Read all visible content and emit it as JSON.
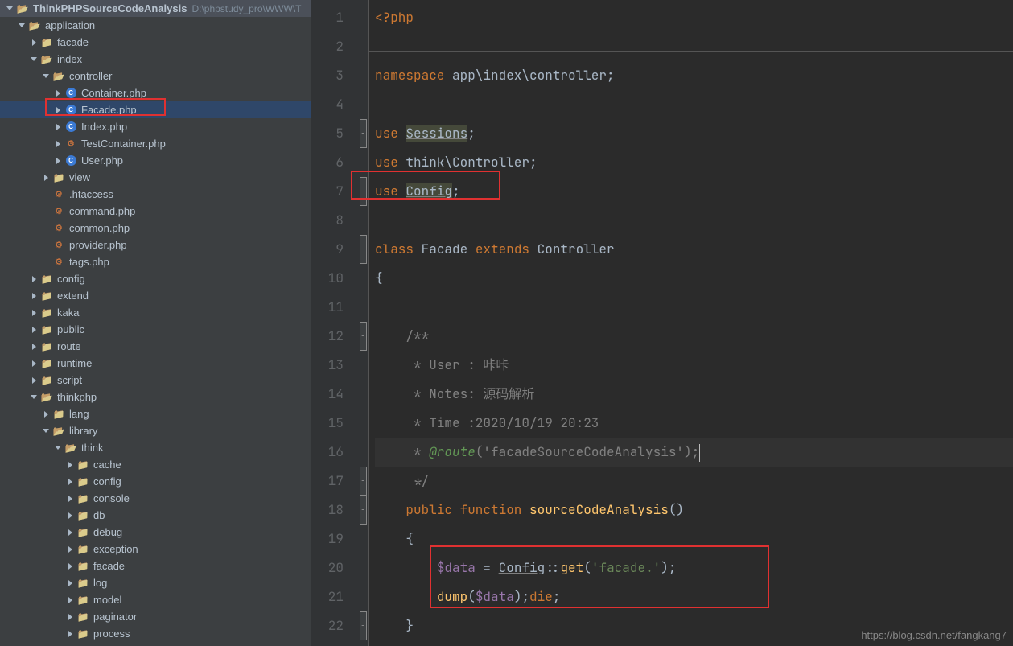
{
  "project": {
    "name": "ThinkPHPSourceCodeAnalysis",
    "path": "D:\\phpstudy_pro\\WWW\\T"
  },
  "tree": [
    {
      "d": 0,
      "exp": "down",
      "icon": "folder-open",
      "label": "ThinkPHPSourceCodeAnalysis",
      "suffix": "D:\\phpstudy_pro\\WWW\\T",
      "bold": true
    },
    {
      "d": 1,
      "exp": "down",
      "icon": "folder-open",
      "label": "application"
    },
    {
      "d": 2,
      "exp": "right",
      "icon": "folder",
      "label": "facade"
    },
    {
      "d": 2,
      "exp": "down",
      "icon": "folder-open",
      "label": "index"
    },
    {
      "d": 3,
      "exp": "down",
      "icon": "folder-open",
      "label": "controller"
    },
    {
      "d": 4,
      "exp": "right",
      "icon": "php",
      "label": "Container.php"
    },
    {
      "d": 4,
      "exp": "right",
      "icon": "php",
      "label": "Facade.php",
      "sel": true,
      "boxed": true
    },
    {
      "d": 4,
      "exp": "right",
      "icon": "php",
      "label": "Index.php"
    },
    {
      "d": 4,
      "exp": "right",
      "icon": "gear",
      "label": "TestContainer.php"
    },
    {
      "d": 4,
      "exp": "right",
      "icon": "php",
      "label": "User.php"
    },
    {
      "d": 3,
      "exp": "right",
      "icon": "folder",
      "label": "view"
    },
    {
      "d": 3,
      "exp": "",
      "icon": "gear",
      "label": ".htaccess"
    },
    {
      "d": 3,
      "exp": "",
      "icon": "gear",
      "label": "command.php"
    },
    {
      "d": 3,
      "exp": "",
      "icon": "gear",
      "label": "common.php"
    },
    {
      "d": 3,
      "exp": "",
      "icon": "gear",
      "label": "provider.php"
    },
    {
      "d": 3,
      "exp": "",
      "icon": "gear",
      "label": "tags.php"
    },
    {
      "d": 2,
      "exp": "right",
      "icon": "folder",
      "label": "config"
    },
    {
      "d": 2,
      "exp": "right",
      "icon": "folder",
      "label": "extend"
    },
    {
      "d": 2,
      "exp": "right",
      "icon": "folder",
      "label": "kaka"
    },
    {
      "d": 2,
      "exp": "right",
      "icon": "folder",
      "label": "public"
    },
    {
      "d": 2,
      "exp": "right",
      "icon": "folder",
      "label": "route"
    },
    {
      "d": 2,
      "exp": "right",
      "icon": "folder",
      "label": "runtime"
    },
    {
      "d": 2,
      "exp": "right",
      "icon": "folder",
      "label": "script"
    },
    {
      "d": 2,
      "exp": "down",
      "icon": "folder-open",
      "label": "thinkphp"
    },
    {
      "d": 3,
      "exp": "right",
      "icon": "folder",
      "label": "lang"
    },
    {
      "d": 3,
      "exp": "down",
      "icon": "folder-open",
      "label": "library"
    },
    {
      "d": 4,
      "exp": "down",
      "icon": "folder-open",
      "label": "think"
    },
    {
      "d": 5,
      "exp": "right",
      "icon": "folder",
      "label": "cache"
    },
    {
      "d": 5,
      "exp": "right",
      "icon": "folder",
      "label": "config"
    },
    {
      "d": 5,
      "exp": "right",
      "icon": "folder",
      "label": "console"
    },
    {
      "d": 5,
      "exp": "right",
      "icon": "folder",
      "label": "db"
    },
    {
      "d": 5,
      "exp": "right",
      "icon": "folder",
      "label": "debug"
    },
    {
      "d": 5,
      "exp": "right",
      "icon": "folder",
      "label": "exception"
    },
    {
      "d": 5,
      "exp": "right",
      "icon": "folder",
      "label": "facade"
    },
    {
      "d": 5,
      "exp": "right",
      "icon": "folder",
      "label": "log"
    },
    {
      "d": 5,
      "exp": "right",
      "icon": "folder",
      "label": "model"
    },
    {
      "d": 5,
      "exp": "right",
      "icon": "folder",
      "label": "paginator"
    },
    {
      "d": 5,
      "exp": "right",
      "icon": "folder",
      "label": "process"
    }
  ],
  "code": {
    "lines": [
      "1",
      "2",
      "3",
      "4",
      "5",
      "6",
      "7",
      "8",
      "9",
      "10",
      "11",
      "12",
      "13",
      "14",
      "15",
      "16",
      "17",
      "18",
      "19",
      "20",
      "21",
      "22"
    ],
    "l1": "<?php",
    "l3_ns": "namespace",
    "l3_rest": " app\\index\\controller;",
    "l5_use": "use ",
    "l5_cls": "Sessions",
    "l5_end": ";",
    "l6_use": "use ",
    "l6_rest": "think\\Controller;",
    "l7_use": "use ",
    "l7_cls": "Config",
    "l7_end": ";",
    "l9_class": "class",
    "l9_name": " Facade ",
    "l9_ext": "extends",
    "l9_sup": " Controller",
    "l10": "{",
    "l12": "    /**",
    "l13": "     * User : 咔咔",
    "l14": "     * Notes: 源码解析",
    "l15": "     * Time :2020/10/19 20:23",
    "l16_a": "     * ",
    "l16_b": "@route",
    "l16_c": "('facadeSourceCodeAnalysis');",
    "l17": "     */",
    "l18_a": "    ",
    "l18_pub": "public ",
    "l18_fun": "function ",
    "l18_name": "sourceCodeAnalysis",
    "l18_par": "()",
    "l19": "    {",
    "l20_a": "        ",
    "l20_var": "$data",
    "l20_eq": " = ",
    "l20_cls": "Config",
    "l20_op": "::",
    "l20_m": "get",
    "l20_p": "(",
    "l20_s": "'facade.'",
    "l20_e": ");",
    "l21_a": "        ",
    "l21_d": "dump",
    "l21_p": "(",
    "l21_v": "$data",
    "l21_e": ");",
    "l21_die": "die",
    "l21_s": ";",
    "l22": "    }"
  },
  "watermark": "https://blog.csdn.net/fangkang7"
}
